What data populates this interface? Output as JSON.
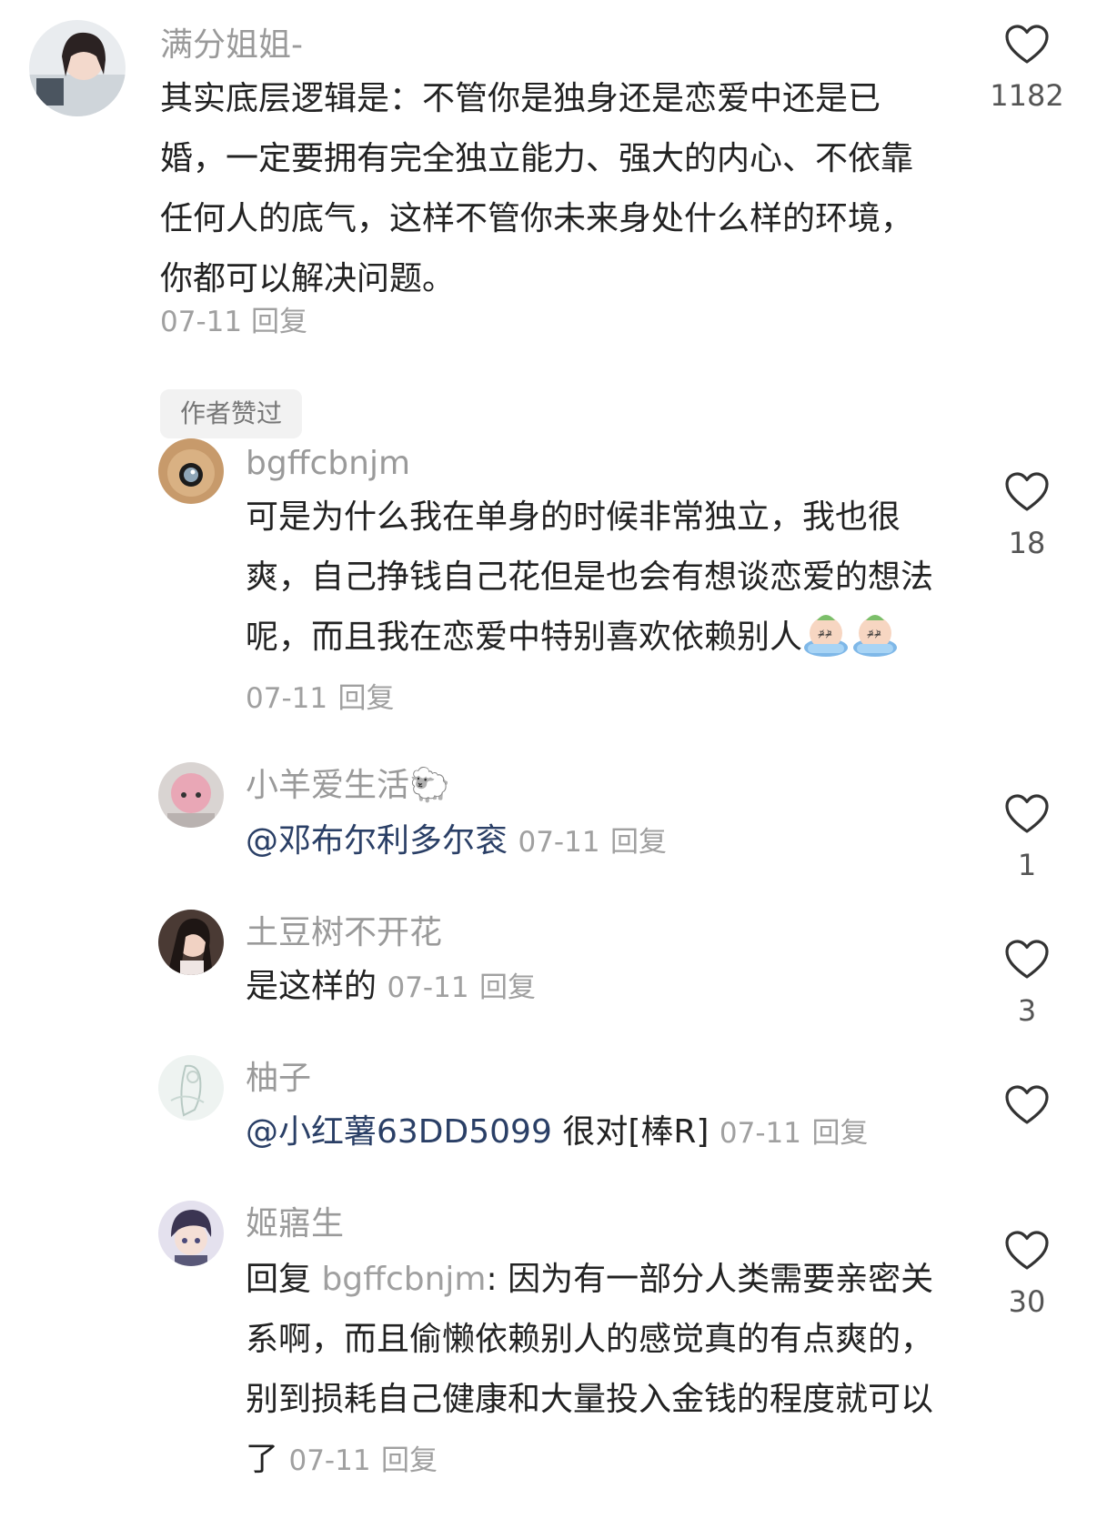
{
  "comments": [
    {
      "username": "满分姐姐-",
      "text": "其实底层逻辑是：不管你是独身还是恋爱中还是已婚，一定要拥有完全独立能力、强大的内心、不依靠任何人的底气，这样不管你未来身处什么样的环境，你都可以解决问题。",
      "date": "07-11",
      "reply_label": "回复",
      "likes": "1182",
      "badge": "作者赞过"
    },
    {
      "username": "bgffcbnjm",
      "text": "可是为什么我在单身的时候非常独立，我也很爽，自己挣钱自己花但是也会有想谈恋爱的想法呢，而且我在恋爱中特别喜欢依赖别人",
      "emoji_name": "crying-face-emoji",
      "date": "07-11",
      "reply_label": "回复",
      "likes": "18"
    },
    {
      "username": "小羊爱生活",
      "username_emoji": "🐑",
      "mention": "@邓布尔利多尔衮",
      "date": "07-11",
      "reply_label": "回复",
      "likes": "1"
    },
    {
      "username": "土豆树不开花",
      "text": "是这样的",
      "date": "07-11",
      "reply_label": "回复",
      "likes": "3"
    },
    {
      "username": "柚子",
      "mention": "@小红薯63DD5099",
      "text": " 很对[棒R]",
      "date": "07-11",
      "reply_label": "回复",
      "likes": ""
    },
    {
      "username": "姬寤生",
      "reply_prefix": "回复 ",
      "reply_target": "bgffcbnjm",
      "text": ": 因为有一部分人类需要亲密关系啊，而且偷懒依赖别人的感觉真的有点爽的，别到损耗自己健康和大量投入金钱的程度就可以了",
      "date": "07-11",
      "reply_label": "回复",
      "likes": "30"
    }
  ],
  "icons": {
    "like": "heart-outline-icon"
  },
  "colors": {
    "username": "#9a9a9a",
    "meta": "#a0a0a0",
    "mention": "#2a3f66",
    "text": "#222222"
  }
}
